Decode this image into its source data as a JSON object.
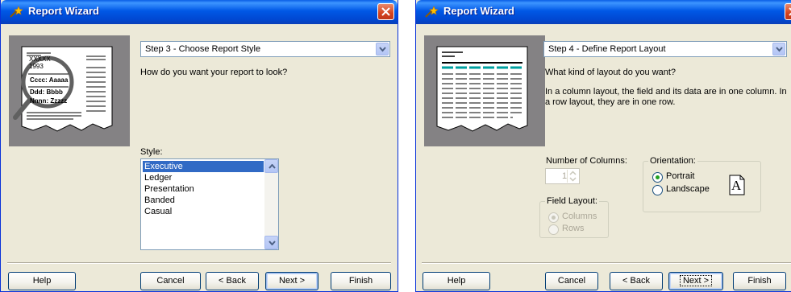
{
  "window1": {
    "title": "Report Wizard",
    "step": "Step 3 - Choose Report Style",
    "question": "How do you want your report to look?",
    "style_label": "Style:",
    "styles": [
      "Executive",
      "Ledger",
      "Presentation",
      "Banded",
      "Casual"
    ],
    "selected_style": "Executive",
    "illustration": {
      "line1": "XXXXX",
      "line2": "1993",
      "line3": "Cccc: Aaaaa",
      "line4": "Ddd: Bbbb",
      "line5": "Nnnn: Zzzzz"
    },
    "buttons": {
      "help": "Help",
      "cancel": "Cancel",
      "back": "< Back",
      "next": "Next >",
      "finish": "Finish"
    }
  },
  "window2": {
    "title": "Report Wizard",
    "step": "Step 4 - Define Report Layout",
    "question": "What kind of layout do you want?",
    "description": "In a column layout, the field and its data are in one column. In a row layout, they are in one row.",
    "columns_label": "Number of Columns:",
    "columns_value": "1",
    "orientation_label": "Orientation:",
    "orientation_options": [
      "Portrait",
      "Landscape"
    ],
    "orientation_selected": "Portrait",
    "orientation_icon_letter": "A",
    "field_layout_label": "Field Layout:",
    "field_layout_options": [
      "Columns",
      "Rows"
    ],
    "field_layout_selected": "Columns",
    "buttons": {
      "help": "Help",
      "cancel": "Cancel",
      "back": "< Back",
      "next": "Next >",
      "finish": "Finish"
    }
  },
  "colors": {
    "titlebar": "#0058E6",
    "dialog_bg": "#ECE9D8",
    "selection": "#316AC5",
    "close": "#D4431E"
  }
}
